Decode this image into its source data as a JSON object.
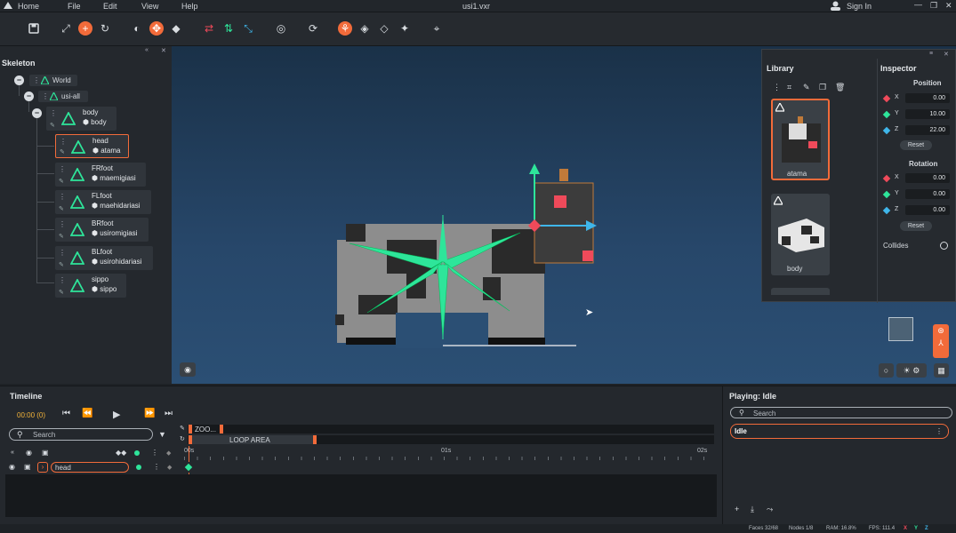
{
  "topbar": {
    "home": "Home",
    "file": "File",
    "edit": "Edit",
    "view": "View",
    "help": "Help",
    "title": "usi1.vxr",
    "sign_in": "Sign In"
  },
  "skeleton": {
    "title": "Skeleton",
    "world": "World",
    "usi_all": "usi-all",
    "nodes": [
      {
        "name": "body",
        "sub": "body"
      },
      {
        "name": "head",
        "sub": "atama"
      },
      {
        "name": "FRfoot",
        "sub": "maemigiasi"
      },
      {
        "name": "FLfoot",
        "sub": "maehidariasi"
      },
      {
        "name": "BRfoot",
        "sub": "usiromigiasi"
      },
      {
        "name": "BLfoot",
        "sub": "usirohidariasi"
      },
      {
        "name": "sippo",
        "sub": "sippo"
      }
    ]
  },
  "library": {
    "title": "Library",
    "items": [
      {
        "label": "atama"
      },
      {
        "label": "body"
      }
    ]
  },
  "inspector": {
    "title": "Inspector",
    "position_label": "Position",
    "rotation_label": "Rotation",
    "position": {
      "x": "0.00",
      "y": "10.00",
      "z": "22.00"
    },
    "rotation": {
      "x": "0.00",
      "y": "0.00",
      "z": "0.00"
    },
    "reset": "Reset",
    "collides": "Collides",
    "axis_x": "X",
    "axis_y": "Y",
    "axis_z": "Z"
  },
  "timeline": {
    "title": "Timeline",
    "time": "00:00 (0)",
    "search_placeholder": "Search",
    "zoom": "ZOO...",
    "loop_area": "LOOP AREA",
    "ticks": [
      "00s",
      "01s",
      "02s"
    ],
    "track": "head"
  },
  "playing": {
    "title": "Playing: Idle",
    "search_placeholder": "Search",
    "item": "Idle"
  },
  "status": {
    "faces": "Faces 32/68",
    "nodes": "Nodes 1/8",
    "ram": "RAM: 16.8%",
    "fps": "FPS: 111.4",
    "x": "X",
    "y": "Y",
    "z": "Z"
  },
  "colors": {
    "accent": "#f26b3a",
    "green": "#2ee59a",
    "blue": "#3fb6ea",
    "red": "#ef4a5a"
  }
}
